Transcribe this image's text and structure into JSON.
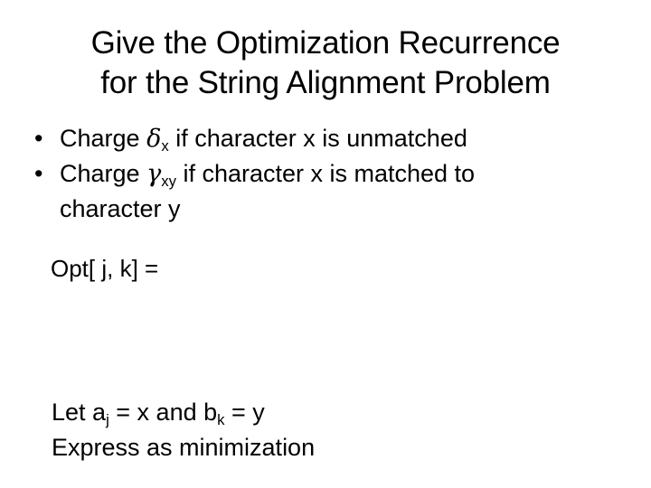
{
  "slide": {
    "background_color": "#ffffff",
    "text_color": "#000000",
    "title": {
      "line1": "Give the Optimization Recurrence",
      "line2": "for the String Alignment Problem"
    },
    "bullets": [
      {
        "marker": "•",
        "prefix": "Charge ",
        "symbol": "δ",
        "subscript": "x",
        "suffix": " if character x is unmatched"
      },
      {
        "marker": "•",
        "prefix": "Charge ",
        "symbol": "γ",
        "subscript": "xy",
        "suffix": " if character x is matched to",
        "continuation": "character y"
      }
    ],
    "opt_line": "Opt[ j, k] =",
    "footer": {
      "line1_part1": "Let a",
      "line1_sub1": "j",
      "line1_part2": " = x and b",
      "line1_sub2": "k",
      "line1_part3": " = y",
      "line2": "Express as minimization"
    }
  }
}
